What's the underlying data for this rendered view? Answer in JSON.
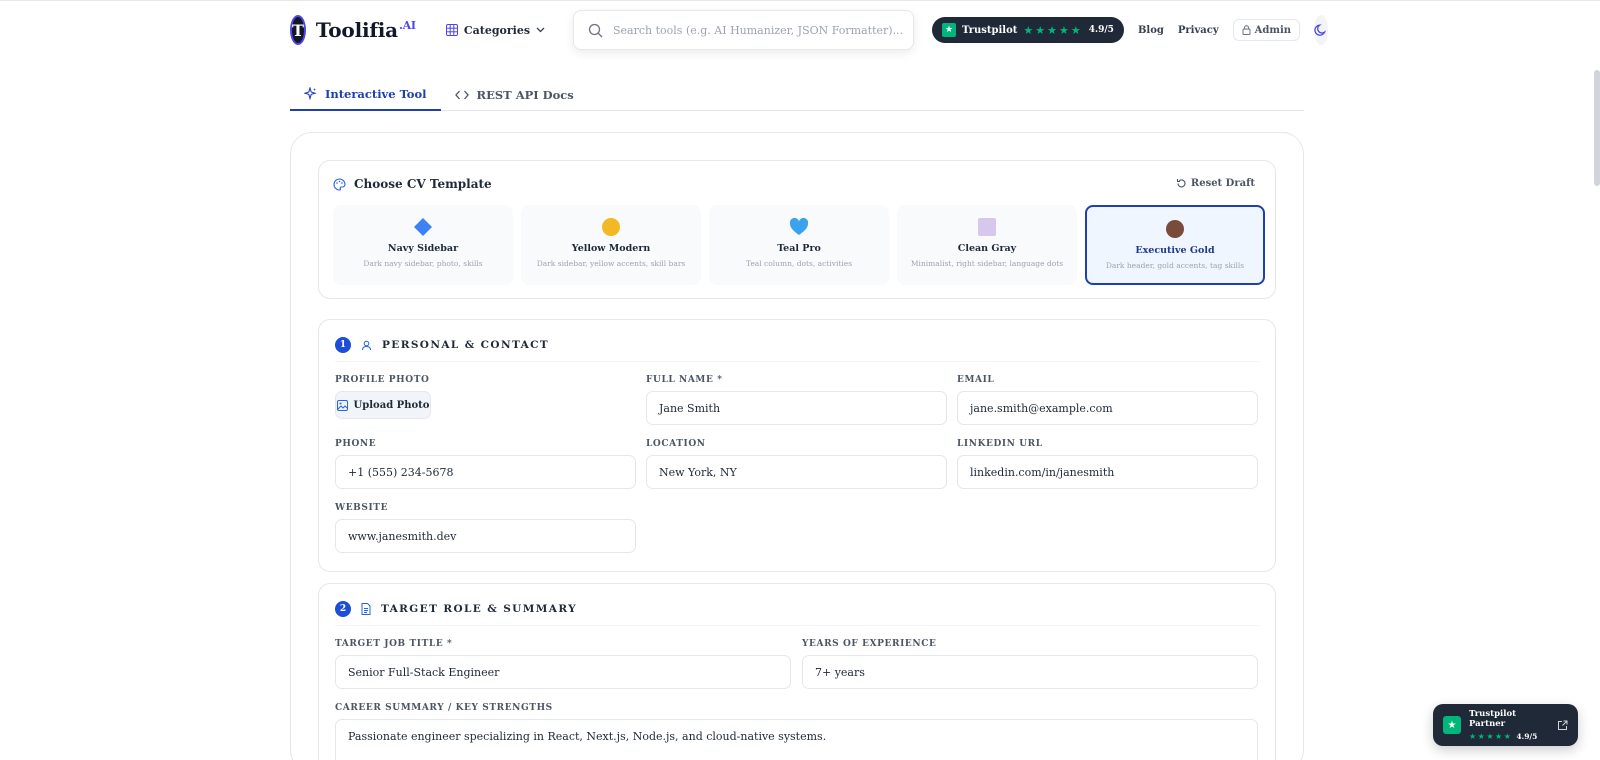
{
  "header": {
    "brand": "Toolifia",
    "brand_sup": ".AI",
    "categories_label": "Categories",
    "search_placeholder": "Search tools (e.g. AI Humanizer, JSON Formatter)...",
    "trustpilot_label": "Trustpilot",
    "trustpilot_stars": "★★★★★",
    "trustpilot_rating": "4.9/5",
    "nav": {
      "blog": "Blog",
      "privacy": "Privacy",
      "admin": "Admin"
    }
  },
  "tabs": [
    {
      "label": "Interactive Tool",
      "icon": "sparkle-icon",
      "active": true
    },
    {
      "label": "REST API Docs",
      "icon": "code-icon",
      "active": false
    }
  ],
  "templates": {
    "heading": "Choose CV Template",
    "reset_label": "Reset Draft",
    "items": [
      {
        "name": "Navy Sidebar",
        "desc": "Dark navy sidebar, photo, skills",
        "emoji": "🔷"
      },
      {
        "name": "Yellow Modern",
        "desc": "Dark sidebar, yellow accents, skill bars",
        "emoji": "🟡"
      },
      {
        "name": "Teal Pro",
        "desc": "Teal column, dots, activities",
        "emoji": "💙"
      },
      {
        "name": "Clean Gray",
        "desc": "Minimalist, right sidebar, language dots",
        "emoji": "⬜"
      },
      {
        "name": "Executive Gold",
        "desc": "Dark header, gold accents, tag skills",
        "emoji": "🟤"
      }
    ]
  },
  "section1": {
    "number": "1",
    "title": "PERSONAL & CONTACT",
    "photo_label": "PROFILE PHOTO",
    "upload_label": "Upload Photo",
    "full_name_label": "FULL NAME *",
    "full_name": "Jane Smith",
    "email_label": "EMAIL",
    "email": "jane.smith@example.com",
    "phone_label": "PHONE",
    "phone": "+1 (555) 234-5678",
    "location_label": "LOCATION",
    "location": "New York, NY",
    "linkedin_label": "LINKEDIN URL",
    "linkedin": "linkedin.com/in/janesmith",
    "website_label": "WEBSITE",
    "website": "www.janesmith.dev"
  },
  "section2": {
    "number": "2",
    "title": "TARGET ROLE & SUMMARY",
    "job_title_label": "TARGET JOB TITLE *",
    "job_title": "Senior Full-Stack Engineer",
    "years_label": "YEARS OF EXPERIENCE",
    "years": "7+ years",
    "summary_label": "CAREER SUMMARY / KEY STRENGTHS",
    "summary": "Passionate engineer specializing in React, Next.js, Node.js, and cloud-native systems."
  },
  "float_badge": {
    "title": "Trustpilot Partner",
    "stars": "★★★★★",
    "rating": "4.9/5"
  },
  "colors": {
    "accent": "#1e40af",
    "trustpilot_green": "#00b67a",
    "dark": "#1f2937"
  }
}
